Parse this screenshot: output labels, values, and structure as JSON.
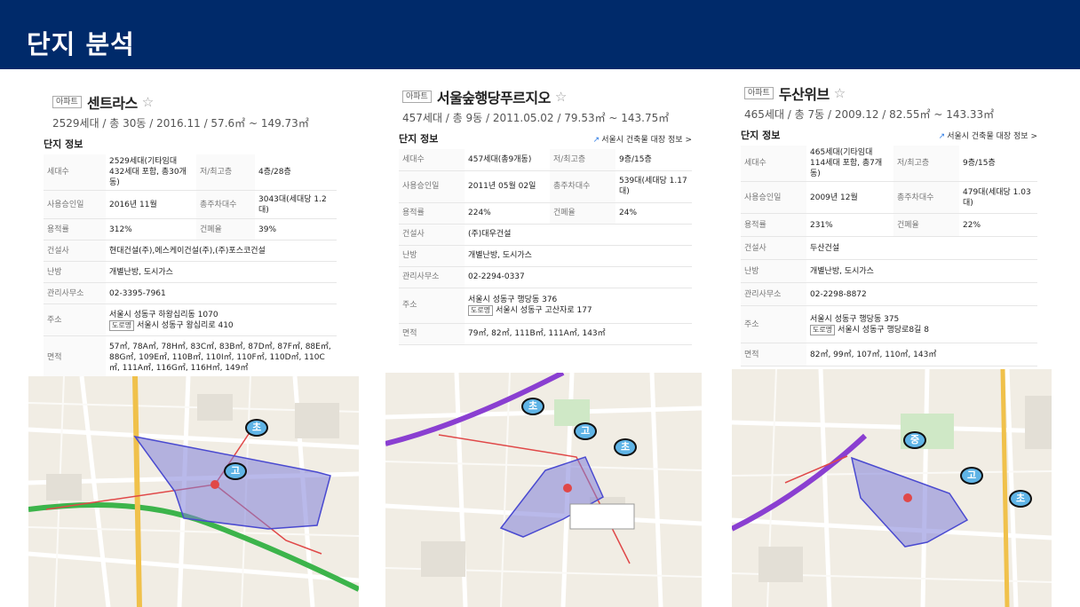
{
  "page": {
    "title": "단지 분석"
  },
  "common": {
    "tag": "아파트",
    "star": "☆",
    "section_title": "단지 정보",
    "registry_link": "서울시 건축물 대장 정보 >",
    "road_tag": "도로명"
  },
  "complexes": [
    {
      "name": "센트라스",
      "summary": "2529세대 / 총 30동 / 2016.11 / 57.6㎡ ~ 149.73㎡",
      "show_link": false,
      "rows": {
        "households_k": "세대수",
        "households_v": "2529세대(기타임대 432세대 포함, 총30개동)",
        "floors_k": "저/최고층",
        "floors_v": "4층/28층",
        "approval_k": "사용승인일",
        "approval_v": "2016년 11월",
        "parking_k": "총주차대수",
        "parking_v": "3043대(세대당 1.2대)",
        "far_k": "용적률",
        "far_v": "312%",
        "bcr_k": "건폐율",
        "bcr_v": "39%",
        "builder_k": "건설사",
        "builder_v": "현대건설(주),에스케이건설(주),(주)포스코건설",
        "heating_k": "난방",
        "heating_v": "개별난방, 도시가스",
        "office_k": "관리사무소",
        "office_v": "02-3395-7961",
        "addr_k": "주소",
        "addr_v": "서울시 성동구 하왕십리동 1070",
        "road_v": "서울시 성동구 왕십리로 410",
        "area_k": "면적",
        "area_v": "57㎡, 78A㎡, 78H㎡, 83C㎡, 83B㎡, 87D㎡, 87F㎡, 88E㎡, 88G㎡, 109E㎡, 110B㎡, 110I㎡, 110F㎡, 110D㎡, 110C㎡, 111A㎡, 116G㎡, 116H㎡, 149㎡"
      }
    },
    {
      "name": "서울숲행당푸르지오",
      "summary": "457세대 / 총 9동 / 2011.05.02 / 79.53㎡ ~ 143.75㎡",
      "show_link": true,
      "rows": {
        "households_k": "세대수",
        "households_v": "457세대(총9개동)",
        "floors_k": "저/최고층",
        "floors_v": "9층/15층",
        "approval_k": "사용승인일",
        "approval_v": "2011년 05월 02일",
        "parking_k": "총주차대수",
        "parking_v": "539대(세대당 1.17대)",
        "far_k": "용적률",
        "far_v": "224%",
        "bcr_k": "건폐율",
        "bcr_v": "24%",
        "builder_k": "건설사",
        "builder_v": "(주)대우건설",
        "heating_k": "난방",
        "heating_v": "개별난방, 도시가스",
        "office_k": "관리사무소",
        "office_v": "02-2294-0337",
        "addr_k": "주소",
        "addr_v": "서울시 성동구 행당동 376",
        "road_v": "서울시 성동구 고산자로 177",
        "area_k": "면적",
        "area_v": "79㎡, 82㎡, 111B㎡, 111A㎡, 143㎡"
      }
    },
    {
      "name": "두산위브",
      "summary": "465세대 / 총 7동 / 2009.12 / 82.55㎡ ~ 143.33㎡",
      "show_link": true,
      "rows": {
        "households_k": "세대수",
        "households_v": "465세대(기타임대 114세대 포함, 총7개동)",
        "floors_k": "저/최고층",
        "floors_v": "9층/15층",
        "approval_k": "사용승인일",
        "approval_v": "2009년 12월",
        "parking_k": "총주차대수",
        "parking_v": "479대(세대당 1.03대)",
        "far_k": "용적률",
        "far_v": "231%",
        "bcr_k": "건폐율",
        "bcr_v": "22%",
        "builder_k": "건설사",
        "builder_v": "두산건설",
        "heating_k": "난방",
        "heating_v": "개별난방, 도시가스",
        "office_k": "관리사무소",
        "office_v": "02-2298-8872",
        "addr_k": "주소",
        "addr_v": "서울시 성동구 행당동 375",
        "road_v": "서울시 성동구 행당로8길 8",
        "area_k": "면적",
        "area_v": "82㎡, 99㎡, 107㎡, 110㎡, 143㎡"
      }
    }
  ],
  "maps": [
    {
      "labels": {
        "elem": "초",
        "high": "고"
      },
      "colors": {
        "polygon": "#7f7fd9",
        "route": "#e04848",
        "subway": "#3cb44b"
      }
    },
    {
      "labels": {
        "elem": "초",
        "high": "고",
        "elem2": "초"
      },
      "colors": {
        "polygon": "#7f7fd9",
        "route": "#e04848",
        "subway": "#8a3fd1"
      }
    },
    {
      "labels": {
        "middle": "중",
        "high": "고",
        "elem": "초"
      },
      "colors": {
        "polygon": "#7f7fd9",
        "route": "#e04848",
        "subway": "#8a3fd1"
      }
    }
  ]
}
